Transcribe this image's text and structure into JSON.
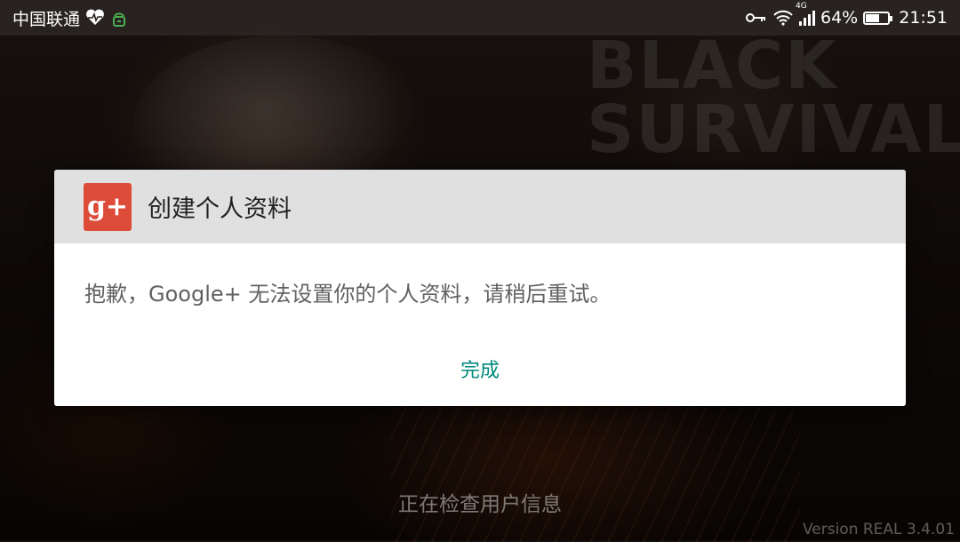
{
  "status_bar": {
    "carrier": "中国联通",
    "battery_percent": "64%",
    "battery_level": 0.64,
    "time": "21:51",
    "network": "4G",
    "icons": [
      "heart-rate-icon",
      "sync-icon",
      "key-icon",
      "wifi-icon",
      "signal-icon",
      "battery-icon"
    ]
  },
  "background": {
    "game_title": "BLACK SURVIVAL"
  },
  "dialog": {
    "logo_text": "g+",
    "title": "创建个人资料",
    "message": "抱歉，Google+ 无法设置你的个人资料，请稍后重试。",
    "action_label": "完成",
    "colors": {
      "header_bg": "#e0e0e0",
      "logo_bg": "#dd4b39",
      "action": "#00897b"
    }
  },
  "footer": {
    "loading_text": "正在检查用户信息",
    "version": "Version  REAL 3.4.01"
  }
}
